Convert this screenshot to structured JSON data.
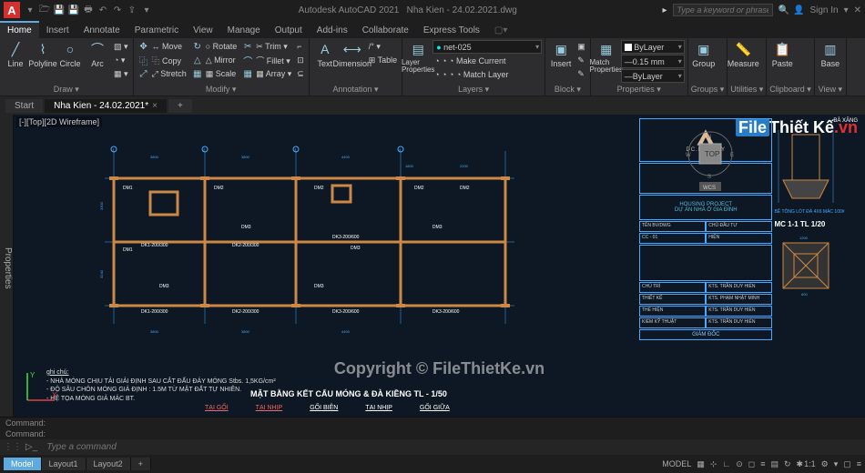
{
  "titlebar": {
    "app": "Autodesk AutoCAD 2021",
    "doc": "Nha Kien - 24.02.2021.dwg",
    "search_placeholder": "Type a keyword or phrase",
    "signin": "Sign In"
  },
  "watermark": {
    "logo_a": "File",
    "logo_b": "Thiết Kế",
    "logo_c": ".vn",
    "copy": "Copyright © FileThietKe.vn"
  },
  "ribbon_tabs": [
    "Home",
    "Insert",
    "Annotate",
    "Parametric",
    "View",
    "Manage",
    "Output",
    "Add-ins",
    "Collaborate",
    "Express Tools"
  ],
  "ribbon_active": "Home",
  "panels": {
    "draw": {
      "title": "Draw ▾",
      "big": [
        {
          "ico": "╱",
          "label": "Line"
        },
        {
          "ico": "⌇",
          "label": "Polyline"
        },
        {
          "ico": "○",
          "label": "Circle"
        },
        {
          "ico": "⌒",
          "label": "Arc"
        }
      ]
    },
    "modify": {
      "title": "Modify ▾",
      "items": [
        [
          "↔ Move",
          "○ Rotate",
          "✂ Trim ▾"
        ],
        [
          "⿻ Copy",
          "△ Mirror",
          "⌒ Fillet ▾"
        ],
        [
          "⤢ Stretch",
          "▦ Scale",
          "▦ Array ▾"
        ]
      ]
    },
    "annot": {
      "title": "Annotation ▾",
      "big": [
        {
          "ico": "A",
          "label": "Text"
        },
        {
          "ico": "⟷",
          "label": "Dimension"
        }
      ],
      "items": [
        "⊞ Table",
        "/° ",
        "⊞ "
      ]
    },
    "layers": {
      "title": "Layers ▾",
      "big": [
        {
          "ico": "▤",
          "label": "Layer Properties"
        }
      ],
      "combo": "net-025",
      "items": [
        "◔ ◔ ◔ Make Current",
        "◔ ◔ ◔ ◔ Match Layer"
      ]
    },
    "block": {
      "title": "Block ▾",
      "big": [
        {
          "ico": "▣",
          "label": "Insert"
        }
      ]
    },
    "props": {
      "title": "Properties ▾",
      "big": [
        {
          "ico": "▦",
          "label": "Match Properties"
        }
      ],
      "combos": [
        "ByLayer",
        "0.15 mm",
        "ByLayer"
      ]
    },
    "groups": {
      "title": "Groups ▾",
      "big": [
        {
          "ico": "▣",
          "label": "Group"
        }
      ]
    },
    "utils": {
      "title": "Utilities ▾",
      "big": [
        {
          "ico": "📏",
          "label": "Measure"
        }
      ]
    },
    "clip": {
      "title": "Clipboard ▾",
      "big": [
        {
          "ico": "📋",
          "label": "Paste"
        }
      ]
    },
    "view": {
      "title": "View ▾",
      "big": [
        {
          "ico": "▥",
          "label": "Base"
        }
      ]
    }
  },
  "doctabs": {
    "start": "Start",
    "file": "Nha Kien - 24.02.2021*"
  },
  "viewport_label": "[-][Top][2D Wireframe]",
  "plan": {
    "beams": [
      "DM1",
      "DM2",
      "DM3",
      "DK1",
      "DK2",
      "DK3"
    ],
    "beam_tags": [
      "DK1-200/300",
      "DK2-200/300",
      "DK3-200/600"
    ],
    "dims_h": [
      "3800",
      "3800",
      "4400",
      "200",
      "200",
      "1800",
      "2200"
    ],
    "dims_v": [
      "3300",
      "3240",
      "200"
    ],
    "title": "MẶT BẰNG  KẾT CẤU MÓNG & ĐÀ KIỀNG   TL - 1/50",
    "notes_h": "ghi chú:",
    "notes": [
      "- NHÀ MÓNG CHỊU TẢI GIẢI ĐỊNH SAU CẮT ĐẤU ĐÁY MÓNG Stbs. 1,5KG/cm²",
      "- ĐỘ SÂU CHÔN MÓNG GIẢ ĐỊNH : 1.5M TỪ MẶT ĐẤT TỰ NHIÊN.",
      "- HỆ TỌA MÓNG GIẢ MÁC BT."
    ],
    "support": [
      "TẠI GỐI",
      "TẠI NHỊP",
      "GỐI BIÊN",
      "TẠI NHỊP",
      "GỐI GIỮA"
    ]
  },
  "titleblock": {
    "logo": "DC.LUXURY",
    "proj1": "HOUSING PROJECT",
    "proj2": "DỰ ÁN NHÀ Ở GIA ĐÌNH",
    "rows": [
      [
        "TÊN BV/DWG",
        "CHỦ ĐẦU TƯ"
      ],
      [
        "CC - 01",
        "HIỆN"
      ],
      [
        "CHỦ TRÌ",
        "KTS. TRẦN DUY HIỂN"
      ],
      [
        "THIẾT KẾ",
        "KTS. PHẠM NHẬT MINH"
      ],
      [
        "THỂ HIỆN",
        "KTS. TRẦN DUY HIỂN"
      ],
      [
        "KIỂM KỸ THUẬT",
        "KTS. TRẦN DUY HIỂN"
      ]
    ],
    "giamdoc": "GIÁM ĐỐC",
    "sec_right": "MC 1-1 TL 1/20",
    "base": "BÊ TÔNG LÓT ĐÁ 4X6 MÁC 100#",
    "baxang": "BÀ XĂNG"
  },
  "navcube": {
    "top": "TOP",
    "wcs": "WCS",
    "n": "N",
    "s": "S",
    "e": "E",
    "w": "W"
  },
  "command": {
    "hist": "Command:",
    "prompt": "Command:",
    "placeholder": "Type a command"
  },
  "layouts": [
    "Model",
    "Layout1",
    "Layout2"
  ],
  "layout_active": "Model",
  "status": {
    "model": "MODEL",
    "scale": "1:1",
    "gear": "⚙"
  }
}
